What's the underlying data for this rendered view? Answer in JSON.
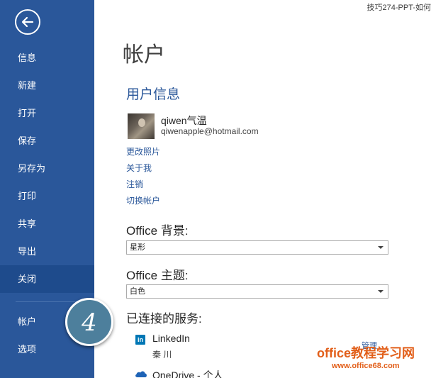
{
  "window_title": "技巧274-PPT-如何",
  "sidebar": {
    "items": [
      {
        "label": "信息"
      },
      {
        "label": "新建"
      },
      {
        "label": "打开"
      },
      {
        "label": "保存"
      },
      {
        "label": "另存为"
      },
      {
        "label": "打印"
      },
      {
        "label": "共享"
      },
      {
        "label": "导出"
      },
      {
        "label": "关闭"
      },
      {
        "label": "帐户"
      },
      {
        "label": "选项"
      }
    ]
  },
  "main": {
    "title": "帐户",
    "user_info": {
      "heading": "用户信息",
      "name": "qiwen气温",
      "email": "qiwenapple@hotmail.com",
      "links": [
        "更改照片",
        "关于我",
        "注销",
        "切换帐户"
      ]
    },
    "background": {
      "label": "Office 背景:",
      "value": "星形"
    },
    "theme": {
      "label": "Office 主题:",
      "value": "白色"
    },
    "services": {
      "heading": "已连接的服务:",
      "linkedin": {
        "icon": "linkedin-icon",
        "icon_text": "in",
        "name": "LinkedIn",
        "user": "秦 川",
        "manage": "管理"
      },
      "onedrive": {
        "icon": "onedrive-icon",
        "name": "OneDrive - 个人"
      }
    }
  },
  "step_marker": "4",
  "watermark": {
    "line1": "office教程学习网",
    "line2": "www.office68.com"
  },
  "colors": {
    "sidebar": "#2a579a",
    "accent": "#2a579a",
    "watermark": "#e25f1a"
  }
}
